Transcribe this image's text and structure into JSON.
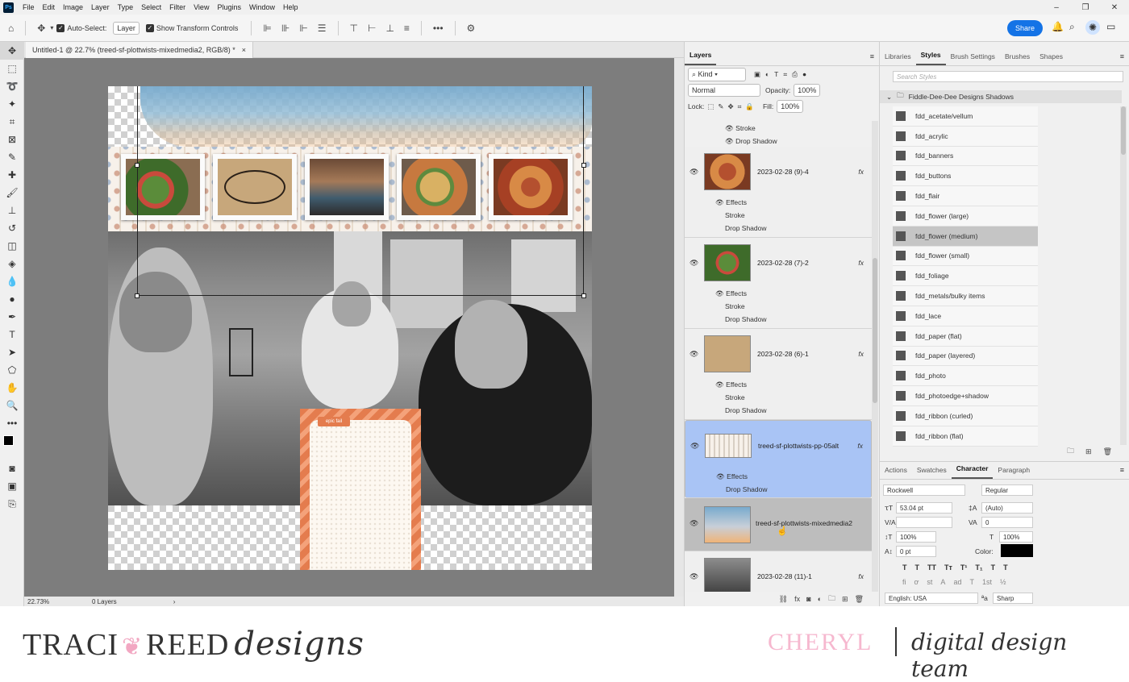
{
  "menubar": {
    "logo": "Ps",
    "items": [
      "File",
      "Edit",
      "Image",
      "Layer",
      "Type",
      "Select",
      "Filter",
      "View",
      "Plugins",
      "Window",
      "Help"
    ]
  },
  "optionsbar": {
    "auto_select_label": "Auto-Select:",
    "auto_select_value": "Layer",
    "transform_label": "Show Transform Controls",
    "more": "•••",
    "share": "Share"
  },
  "document": {
    "tab_title": "Untitled-1 @ 22.7% (treed-sf-plottwists-mixedmedia2, RGB/8) *",
    "close": "×",
    "zoom": "22.73%",
    "layers_count": "0 Layers",
    "journal_tag": "epic fail"
  },
  "layers_panel": {
    "tab": "Layers",
    "filter_kind": "Kind",
    "blend_mode": "Normal",
    "opacity_label": "Opacity:",
    "opacity": "100%",
    "lock_label": "Lock:",
    "fill_label": "Fill:",
    "fill": "100%",
    "top_effects": [
      "Stroke",
      "Drop Shadow"
    ],
    "layers": [
      {
        "name": "2023-02-28 (9)-4",
        "fx": "fx",
        "effects_label": "Effects",
        "effects": [
          "Stroke",
          "Drop Shadow"
        ]
      },
      {
        "name": "2023-02-28 (7)-2",
        "fx": "fx",
        "effects_label": "Effects",
        "effects": [
          "Stroke",
          "Drop Shadow"
        ]
      },
      {
        "name": "2023-02-28 (6)-1",
        "fx": "fx",
        "effects_label": "Effects",
        "effects": [
          "Stroke",
          "Drop Shadow"
        ]
      },
      {
        "name": "treed-sf-plottwists-pp-05alt",
        "fx": "fx",
        "effects_label": "Effects",
        "effects": [
          "Drop Shadow"
        ]
      },
      {
        "name": "treed-sf-plottwists-mixedmedia2"
      },
      {
        "name": "2023-02-28 (11)-1",
        "fx": "fx"
      }
    ]
  },
  "styles_panel": {
    "tabs": [
      "Libraries",
      "Styles",
      "Brush Settings",
      "Brushes",
      "Shapes"
    ],
    "search_placeholder": "Search Styles",
    "group": "Fiddle-Dee-Dee Designs Shadows",
    "items": [
      "fdd_acetate/vellum",
      "fdd_acrylic",
      "fdd_banners",
      "fdd_buttons",
      "fdd_flair",
      "fdd_flower (large)",
      "fdd_flower (medium)",
      "fdd_flower (small)",
      "fdd_foliage",
      "fdd_metals/bulky items",
      "fdd_lace",
      "fdd_paper (flat)",
      "fdd_paper (layered)",
      "fdd_photo",
      "fdd_photoedge+shadow",
      "fdd_ribbon (curled)",
      "fdd_ribbon (flat)"
    ],
    "highlighted": "fdd_flower (medium)"
  },
  "character_panel": {
    "tabs": [
      "Actions",
      "Swatches",
      "Character",
      "Paragraph"
    ],
    "font": "Rockwell",
    "style": "Regular",
    "size": "53.04 pt",
    "leading": "(Auto)",
    "kerning": "",
    "tracking": "0",
    "vscale": "100%",
    "hscale": "100%",
    "baseline": "0 pt",
    "color_label": "Color:",
    "language": "English: USA",
    "antialias": "Sharp",
    "glyphs1": [
      "T",
      "T",
      "TT",
      "Tт",
      "T¹",
      "T₁",
      "T",
      "T"
    ],
    "glyphs2": [
      "fi",
      "ơ",
      "st",
      "A",
      "ad",
      "T",
      "1st",
      "½"
    ]
  },
  "footer": {
    "brand_left": "TRACI",
    "brand_right": "REED",
    "brand_script": "designs",
    "designer": "CHERYL",
    "team": "digital design team"
  }
}
